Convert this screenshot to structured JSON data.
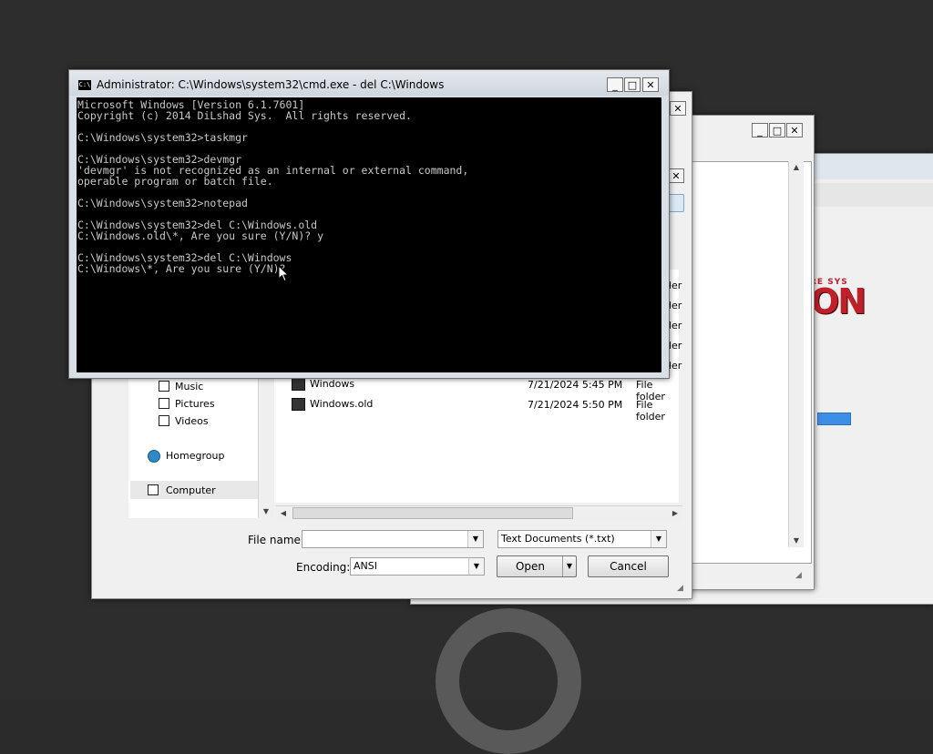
{
  "cmd_window": {
    "title": "Administrator: C:\\Windows\\system32\\cmd.exe - del  C:\\Windows",
    "title_icon": "C:\\",
    "lines": [
      "Microsoft Windows [Version 6.1.7601]",
      "Copyright (c) 2014 DiLshad Sys.  All rights reserved.",
      "",
      "C:\\Windows\\system32>taskmgr",
      "",
      "C:\\Windows\\system32>devmgr",
      "'devmgr' is not recognized as an internal or external command,",
      "operable program or batch file.",
      "",
      "C:\\Windows\\system32>notepad",
      "",
      "C:\\Windows\\system32>del C:\\Windows.old",
      "C:\\Windows.old\\*, Are you sure (Y/N)? y",
      "",
      "C:\\Windows\\system32>del C:\\Windows",
      "C:\\Windows\\*, Are you sure (Y/N)?"
    ]
  },
  "caption_buttons": {
    "minimize": "_",
    "maximize": "□",
    "close": "✕"
  },
  "save_dialog": {
    "nav": {
      "music": "Music",
      "pictures": "Pictures",
      "videos": "Videos",
      "homegroup": "Homegroup",
      "computer": "Computer"
    },
    "files": [
      {
        "name": "Windows",
        "date": "7/21/2024 5:45 PM",
        "type": "File folder"
      },
      {
        "name": "Windows.old",
        "date": "7/21/2024 5:50 PM",
        "type": "File folder"
      }
    ],
    "partial_types": [
      "lder",
      "lder",
      "lder",
      "lder",
      "lder"
    ],
    "file_name_label": "File name:",
    "file_name_value": "",
    "file_type_value": "Text Documents (*.txt)",
    "encoding_label": "Encoding:",
    "encoding_value": "ANSI",
    "open_button": "Open",
    "cancel_button": "Cancel"
  },
  "background_window": {
    "logo_text": "RE SYS",
    "logo_big": "ON"
  },
  "colors": {
    "cmd_bg": "#000000",
    "cmd_fg": "#c0c0c0",
    "desktop": "#2b2b2b",
    "logo_red": "#c0202a",
    "progress_blue": "#3d8ee6"
  }
}
